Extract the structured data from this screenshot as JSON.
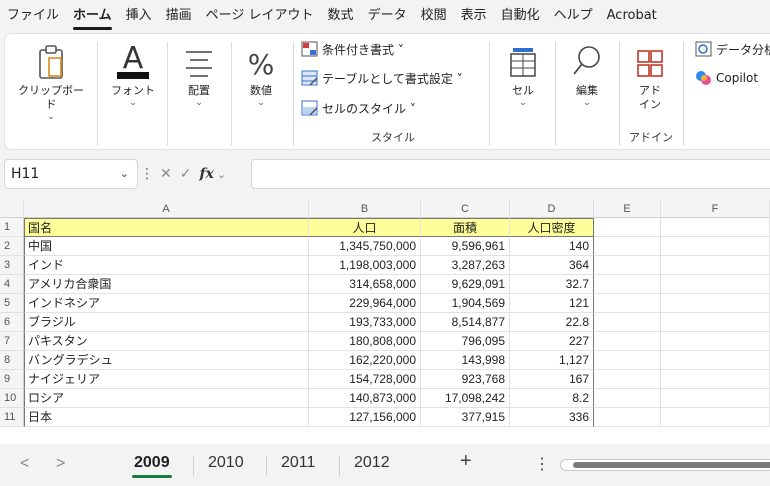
{
  "menu": {
    "items": [
      "ファイル",
      "ホーム",
      "挿入",
      "描画",
      "ページ レイアウト",
      "数式",
      "データ",
      "校閲",
      "表示",
      "自動化",
      "ヘルプ",
      "Acrobat"
    ],
    "active": "ホーム"
  },
  "ribbon": {
    "clipboard": "クリップボード",
    "font": "フォント",
    "alignment": "配置",
    "number": "数値",
    "conditional_format": "条件付き書式 ˅",
    "format_as_table": "テーブルとして書式設定 ˅",
    "cell_styles": "セルのスタイル ˅",
    "styles_group": "スタイル",
    "cells": "セル",
    "editing": "編集",
    "addin_line1": "アド",
    "addin_line2": "イン",
    "addin_group": "アドイン",
    "data_analysis": "データ分析",
    "copilot": "Copilot"
  },
  "formula_bar": {
    "name_box": "H11",
    "fx": "fx",
    "formula": ""
  },
  "columns": [
    "A",
    "B",
    "C",
    "D",
    "E",
    "F"
  ],
  "sheet": {
    "header": [
      "国名",
      "人口",
      "面積",
      "人口密度"
    ],
    "rows": [
      [
        "中国",
        "1,345,750,000",
        "9,596,961",
        "140"
      ],
      [
        "インド",
        "1,198,003,000",
        "3,287,263",
        "364"
      ],
      [
        "アメリカ合衆国",
        "314,658,000",
        "9,629,091",
        "32.7"
      ],
      [
        "インドネシア",
        "229,964,000",
        "1,904,569",
        "121"
      ],
      [
        "ブラジル",
        "193,733,000",
        "8,514,877",
        "22.8"
      ],
      [
        "パキスタン",
        "180,808,000",
        "796,095",
        "227"
      ],
      [
        "バングラデシュ",
        "162,220,000",
        "143,998",
        "1,127"
      ],
      [
        "ナイジェリア",
        "154,728,000",
        "923,768",
        "167"
      ],
      [
        "ロシア",
        "140,873,000",
        "17,098,242",
        "8.2"
      ],
      [
        "日本",
        "127,156,000",
        "377,915",
        "336"
      ]
    ]
  },
  "tabs": {
    "items": [
      "2009",
      "2010",
      "2011",
      "2012"
    ],
    "active": "2009",
    "add": "+",
    "more": "⋮"
  }
}
